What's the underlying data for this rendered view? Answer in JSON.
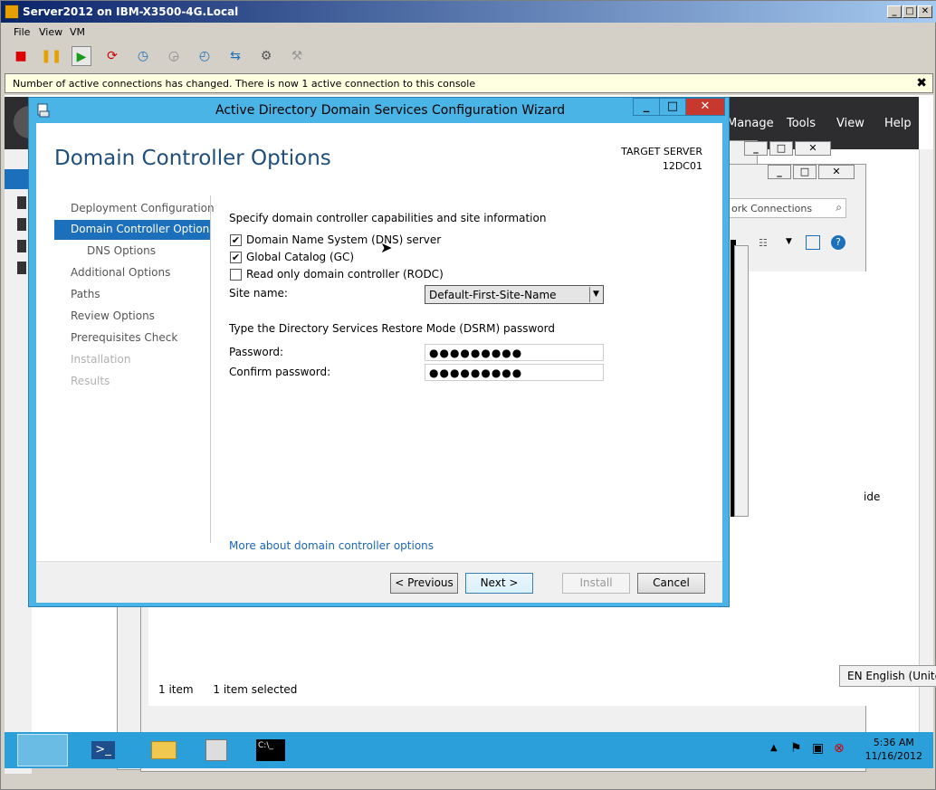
{
  "vm_window": {
    "title": "Server2012 on IBM-X3500-4G.Local",
    "menu": [
      "File",
      "View",
      "VM"
    ],
    "controls": {
      "minimize": "_",
      "maximize": "□",
      "close": "✕"
    }
  },
  "notification": {
    "message": "Number of active connections has changed. There is now 1 active connection to this console",
    "close": "✖"
  },
  "server_manager": {
    "menu": [
      "Manage",
      "Tools",
      "View",
      "Help"
    ],
    "search_placeholder": "ork Connections",
    "side_text": "ide"
  },
  "status_bar": {
    "count": "1 item",
    "selected": "1 item selected"
  },
  "language": "EN English (United St",
  "wizard": {
    "title": "Active Directory Domain Services Configuration Wizard",
    "heading": "Domain Controller Options",
    "target_label": "TARGET SERVER",
    "target_name": "12DC01",
    "nav": [
      {
        "label": "Deployment Configuration",
        "state": "normal"
      },
      {
        "label": "Domain Controller Options",
        "state": "selected"
      },
      {
        "label": "DNS Options",
        "state": "sub"
      },
      {
        "label": "Additional Options",
        "state": "normal"
      },
      {
        "label": "Paths",
        "state": "normal"
      },
      {
        "label": "Review Options",
        "state": "normal"
      },
      {
        "label": "Prerequisites Check",
        "state": "normal"
      },
      {
        "label": "Installation",
        "state": "disabled"
      },
      {
        "label": "Results",
        "state": "disabled"
      }
    ],
    "section1": "Specify domain controller capabilities and site information",
    "options": [
      {
        "label": "Domain Name System (DNS) server",
        "checked": true
      },
      {
        "label": "Global Catalog (GC)",
        "checked": true
      },
      {
        "label": "Read only domain controller (RODC)",
        "checked": false
      }
    ],
    "site_label": "Site name:",
    "site_value": "Default-First-Site-Name",
    "section2": "Type the Directory Services Restore Mode (DSRM) password",
    "password_label": "Password:",
    "password_value": "●●●●●●●●●",
    "confirm_label": "Confirm password:",
    "confirm_value": "●●●●●●●●●",
    "more_link": "More about domain controller options",
    "buttons": {
      "previous": "< Previous",
      "next": "Next >",
      "install": "Install",
      "cancel": "Cancel"
    }
  },
  "clock": {
    "time": "5:36 AM",
    "date": "11/16/2012"
  }
}
